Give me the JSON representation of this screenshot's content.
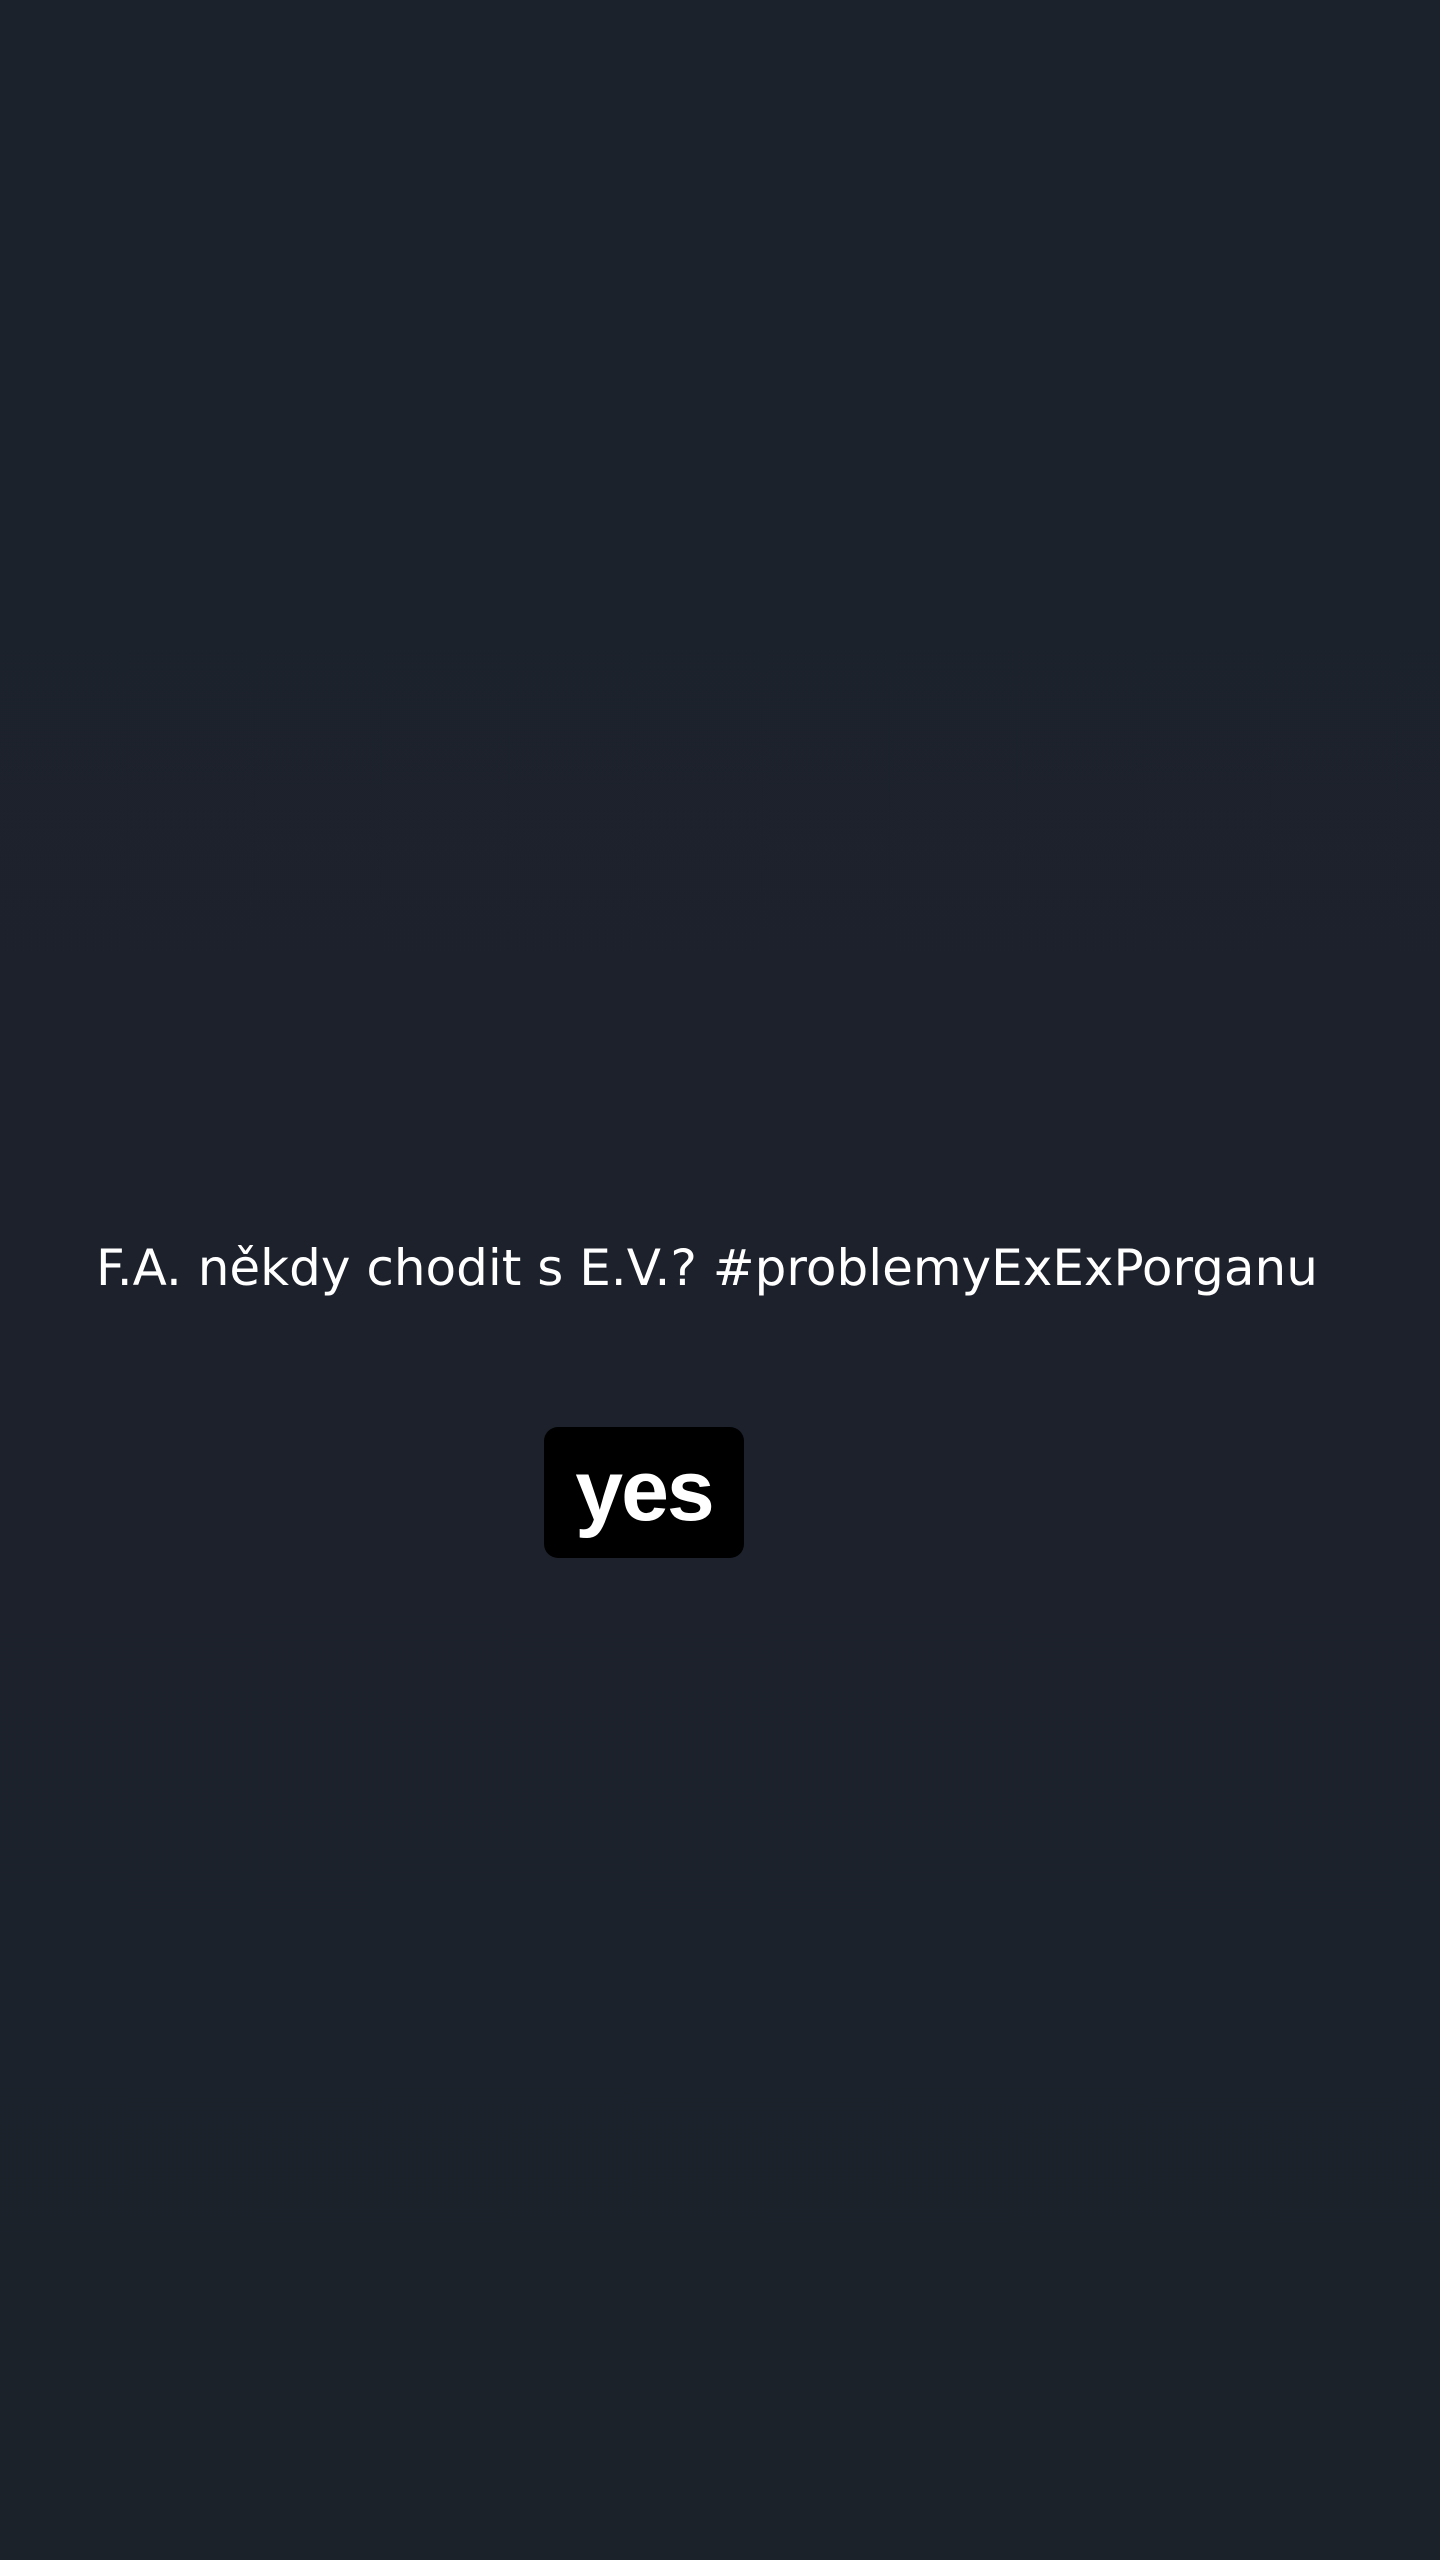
{
  "post": {
    "question_text": "F.A. někdy chodit s E.V.? #problemyExExPorganu",
    "answer_label": "yes"
  },
  "colors": {
    "background": "#1c222b",
    "text": "#ffffff",
    "badge_background": "#000000"
  }
}
